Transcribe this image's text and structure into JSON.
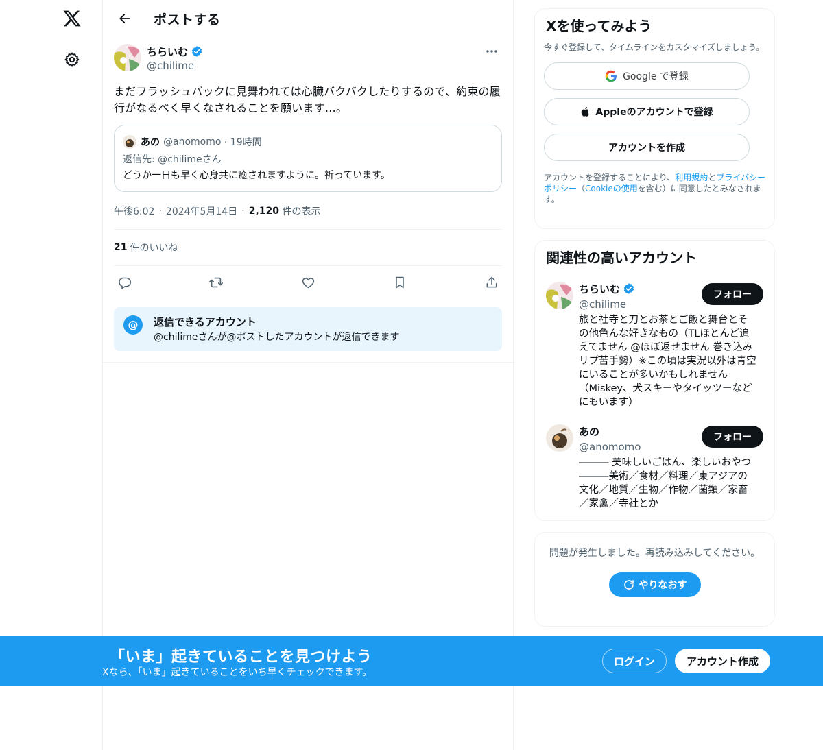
{
  "header": {
    "title": "ポストする"
  },
  "tweet": {
    "author_name": "ちらいむ",
    "author_handle": "@chilime",
    "text": "まだフラッシュバックに見舞われては心臓バクバクしたりするので、約束の履行がなるべく早くなされることを願います…。",
    "quote": {
      "name": "あの",
      "handle": "@anomomo",
      "time": "· 19時間",
      "reply_to": "返信先: @chilimeさん",
      "body": "どうか一日も早く心身共に癒されますように。祈っています。"
    },
    "time": "午後6:02",
    "date": "2024年5月14日",
    "views_count": "2,120",
    "views_label": "件の表示",
    "likes_count": "21",
    "likes_label": "件のいいね",
    "reply_settings": {
      "title": "返信できるアカウント",
      "subtitle": "@chilimeさんが@ポストしたアカウントが返信できます"
    }
  },
  "signup": {
    "title": "Xを使ってみよう",
    "subtitle": "今すぐ登録して、タイムラインをカスタマイズしましょう。",
    "google_label": "Google で登録",
    "apple_label": "Appleのアカウントで登録",
    "create_label": "アカウントを作成",
    "legal_prefix": "アカウントを登録することにより、",
    "legal_terms": "利用規約",
    "legal_and": "と",
    "legal_privacy": "プライバシーポリシー",
    "legal_open": "（",
    "legal_cookie": "Cookieの使用",
    "legal_suffix": "を含む）に同意したとみなされます。"
  },
  "related": {
    "title": "関連性の高いアカウント",
    "accounts": [
      {
        "name": "ちらいむ",
        "handle": "@chilime",
        "bio": "旅と社寺と刀とお茶とご飯と舞台とその他色んな好きなもの（TLほとんど追えてません @ほぼ返せません 巻き込みリプ苦手勢）※この頃は実況以外は青空にいることが多いかもしれません（Miskey、犬スキーやタイッツーなどにもいます）",
        "follow_label": "フォロー"
      },
      {
        "name": "あの",
        "handle": "@anomomo",
        "bio": "――― 美味しいごはん、楽しいおやつ―――美術／食材／料理／東アジアの文化／地質／生物／作物／菌類／家畜／家禽／寺社とか",
        "follow_label": "フォロー"
      }
    ]
  },
  "error": {
    "message": "問題が発生しました。再読み込みしてください。",
    "retry_label": "やりなおす"
  },
  "bottom_bar": {
    "title": "「いま」起きていることを見つけよう",
    "subtitle": "Xなら、「いま」起きていることをいち早くチェックできます。",
    "login_label": "ログイン",
    "create_label": "アカウント作成"
  },
  "colors": {
    "accent": "#1d9bf0",
    "text": "#0f1419",
    "secondary_text": "#536471",
    "border": "#eff3f4",
    "reply_bg": "#e8f5fd"
  },
  "icons": [
    "x-logo-icon",
    "gear-icon",
    "back-arrow-icon",
    "verified-icon",
    "more-icon",
    "reply-icon",
    "retweet-icon",
    "like-icon",
    "bookmark-icon",
    "share-icon",
    "at-icon",
    "google-icon",
    "apple-icon",
    "refresh-icon"
  ]
}
